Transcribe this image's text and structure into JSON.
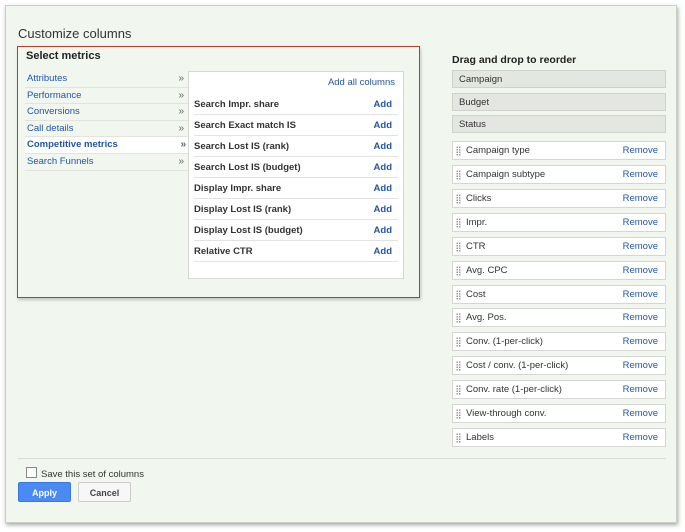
{
  "dialog": {
    "title": "Customize columns",
    "select_metrics_heading": "Select metrics",
    "categories": [
      {
        "label": "Attributes",
        "chevron": "»"
      },
      {
        "label": "Performance",
        "chevron": "»"
      },
      {
        "label": "Conversions",
        "chevron": "»"
      },
      {
        "label": "Call details",
        "chevron": "»"
      },
      {
        "label": "Competitive metrics",
        "chevron": "»"
      },
      {
        "label": "Search Funnels",
        "chevron": "»"
      }
    ],
    "add_all_label": "Add all columns",
    "metrics": [
      {
        "label": "Search Impr. share",
        "action": "Add"
      },
      {
        "label": "Search Exact match IS",
        "action": "Add"
      },
      {
        "label": "Search Lost IS (rank)",
        "action": "Add"
      },
      {
        "label": "Search Lost IS (budget)",
        "action": "Add"
      },
      {
        "label": "Display Impr. share",
        "action": "Add"
      },
      {
        "label": "Display Lost IS (rank)",
        "action": "Add"
      },
      {
        "label": "Display Lost IS (budget)",
        "action": "Add"
      },
      {
        "label": "Relative CTR",
        "action": "Add"
      }
    ],
    "reorder_heading": "Drag and drop to reorder",
    "fixed_columns": [
      "Campaign",
      "Budget",
      "Status"
    ],
    "columns": [
      {
        "label": "Campaign type",
        "action": "Remove"
      },
      {
        "label": "Campaign subtype",
        "action": "Remove"
      },
      {
        "label": "Clicks",
        "action": "Remove"
      },
      {
        "label": "Impr.",
        "action": "Remove"
      },
      {
        "label": "CTR",
        "action": "Remove"
      },
      {
        "label": "Avg. CPC",
        "action": "Remove"
      },
      {
        "label": "Cost",
        "action": "Remove"
      },
      {
        "label": "Avg. Pos.",
        "action": "Remove"
      },
      {
        "label": "Conv. (1-per-click)",
        "action": "Remove"
      },
      {
        "label": "Cost / conv. (1-per-click)",
        "action": "Remove"
      },
      {
        "label": "Conv. rate (1-per-click)",
        "action": "Remove"
      },
      {
        "label": "View-through conv.",
        "action": "Remove"
      },
      {
        "label": "Labels",
        "action": "Remove"
      }
    ],
    "save_label": "Save this set of columns",
    "apply_label": "Apply",
    "cancel_label": "Cancel"
  },
  "colors": {
    "link": "#2255aa",
    "highlight_border": "#c0392b",
    "apply_button": "#4a8af4",
    "dialog_bg": "#f1f6ef"
  }
}
